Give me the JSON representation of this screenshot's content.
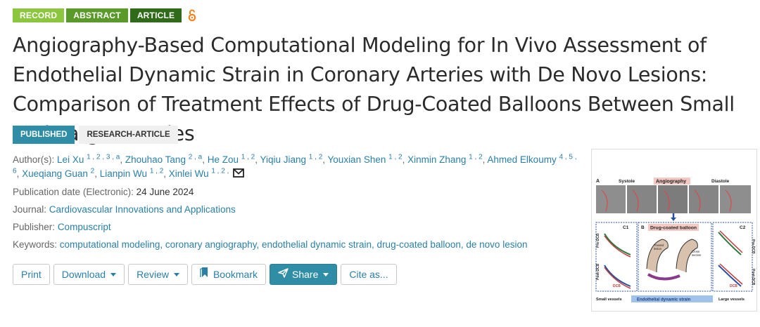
{
  "badges": [
    "RECORD",
    "ABSTRACT",
    "ARTICLE"
  ],
  "title": "Angiography-Based Computational Modeling for In Vivo Assessment of Endothelial Dynamic Strain in Coronary Arteries with De Novo Lesions: Comparison of Treatment Effects of Drug-Coated Balloons Between Small and Large Arteries",
  "status": {
    "published": "PUBLISHED",
    "type": "RESEARCH-ARTICLE"
  },
  "meta": {
    "authors_label": "Author(s):",
    "authors": [
      {
        "name": "Lei Xu",
        "sup": "1 , 2 , 3 , a"
      },
      {
        "name": "Zhouhao Tang",
        "sup": "2 , a"
      },
      {
        "name": "He Zou",
        "sup": "1 , 2"
      },
      {
        "name": "Yiqiu Jiang",
        "sup": "1 , 2"
      },
      {
        "name": "Youxian Shen",
        "sup": "1 , 2"
      },
      {
        "name": "Xinmin Zhang",
        "sup": "1 , 2"
      },
      {
        "name": "Ahmed Elkoumy",
        "sup": "4 , 5 , 6"
      },
      {
        "name": "Xueqiang Guan",
        "sup": "2"
      },
      {
        "name": "Lianpin Wu",
        "sup": "1 , 2"
      },
      {
        "name": "Xinlei Wu",
        "sup": "1 , 2 ,"
      }
    ],
    "pubdate_label": "Publication date (Electronic):",
    "pubdate": "24 June 2024",
    "journal_label": "Journal:",
    "journal": "Cardiovascular Innovations and Applications",
    "publisher_label": "Publisher:",
    "publisher": "Compuscript",
    "keywords_label": "Keywords:",
    "keywords": "computational modeling, coronary angiography, endothelial dynamic strain, drug-coated balloon, de novo lesion"
  },
  "actions": {
    "print": "Print",
    "download": "Download",
    "review": "Review",
    "bookmark": "Bookmark",
    "share": "Share",
    "cite": "Cite as..."
  },
  "figure": {
    "label_a": "A",
    "label_b": "B",
    "label_c1": "C1",
    "label_c2": "C2",
    "systole": "Systole",
    "angiography": "Angiography",
    "diastole": "Diastole",
    "dcb_title": "Drug-coated balloon",
    "treated": "Treated",
    "lesion": "lesion",
    "cross": "Cross",
    "section": "section",
    "pre_dcb": "Pre-DCB",
    "post_dcb": "Post-DCB",
    "dcb": "DCB",
    "small": "Small vessels",
    "eds": "Endothelial dynamic strain",
    "large": "Large vessels"
  }
}
